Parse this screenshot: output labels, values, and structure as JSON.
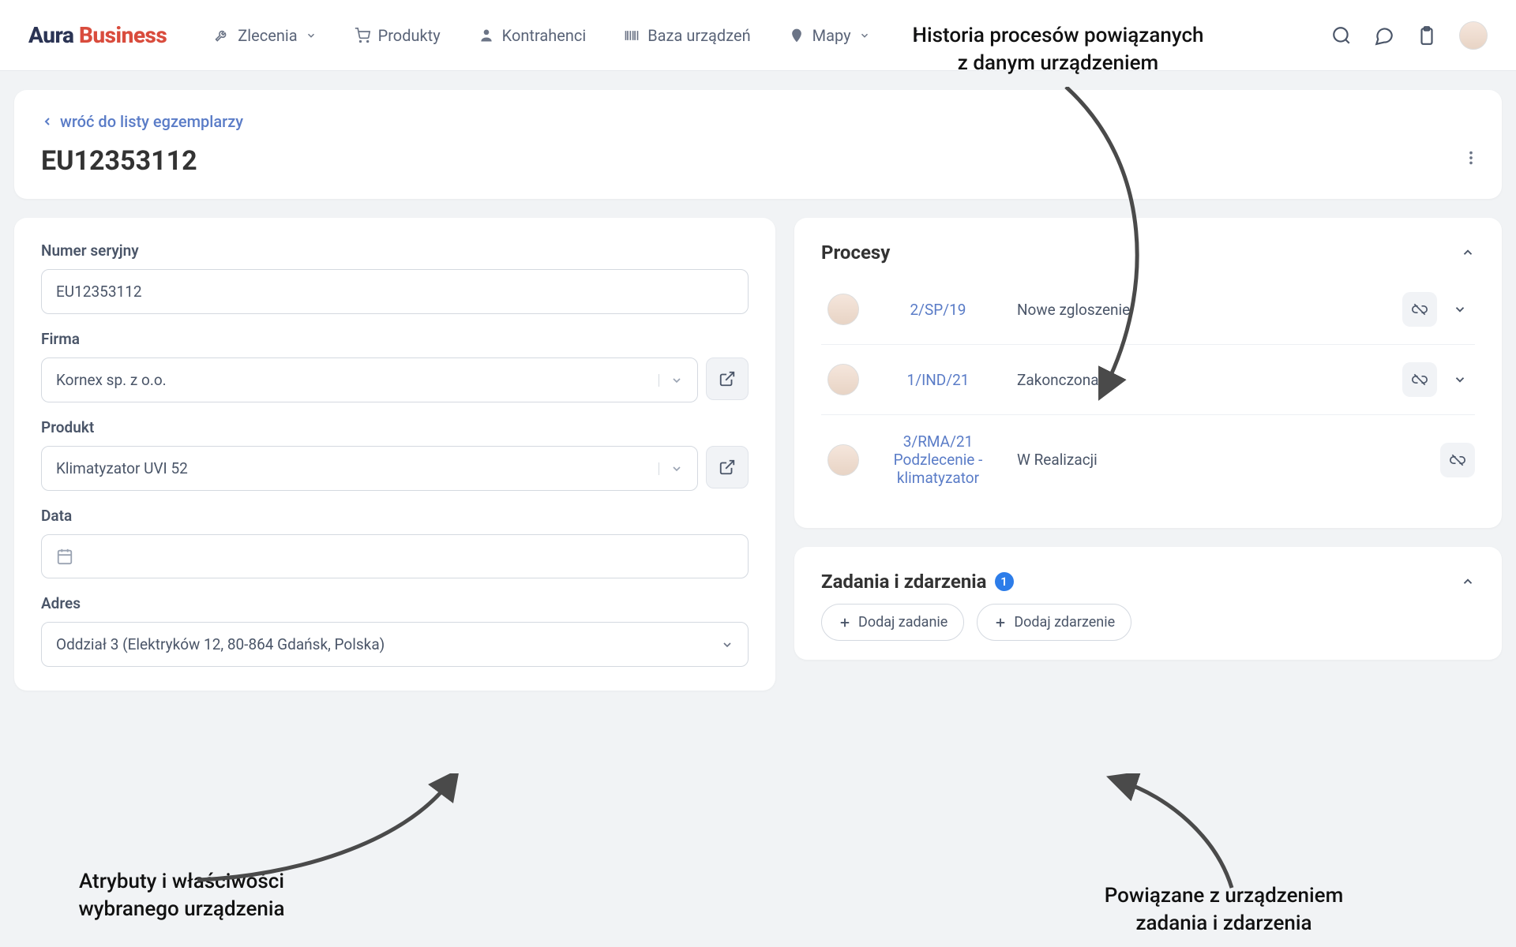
{
  "logo": {
    "part1": "Aura",
    "part2": "Business"
  },
  "nav": {
    "orders": "Zlecenia",
    "products": "Produkty",
    "contractors": "Kontrahenci",
    "devices": "Baza urządzeń",
    "maps": "Mapy"
  },
  "header": {
    "back": "wróć do listy egzemplarzy",
    "title": "EU12353112"
  },
  "form": {
    "serial_label": "Numer seryjny",
    "serial_value": "EU12353112",
    "company_label": "Firma",
    "company_value": "Kornex sp. z o.o.",
    "product_label": "Produkt",
    "product_value": "Klimatyzator UVI 52",
    "date_label": "Data",
    "date_value": "",
    "address_label": "Adres",
    "address_value": "Oddział 3 (Elektryków 12, 80-864 Gdańsk, Polska)"
  },
  "processes": {
    "title": "Procesy",
    "rows": [
      {
        "link": "2/SP/19",
        "status": "Nowe zgloszenie",
        "expandable": true
      },
      {
        "link": "1/IND/21",
        "status": "Zakonczona",
        "expandable": true
      },
      {
        "link": "3/RMA/21 Podzlecenie - klimatyzator",
        "status": "W Realizacji",
        "expandable": false
      }
    ]
  },
  "tasks": {
    "title": "Zadania i zdarzenia",
    "badge": "1",
    "add_task": "Dodaj zadanie",
    "add_event": "Dodaj zdarzenie"
  },
  "annotations": {
    "top": "Historia procesów powiązanych\nz danym urządzeniem",
    "bottom_left": "Atrybuty i właściwości\nwybranego urządzenia",
    "bottom_right": "Powiązane z urządzeniem\nzadania i zdarzenia"
  }
}
